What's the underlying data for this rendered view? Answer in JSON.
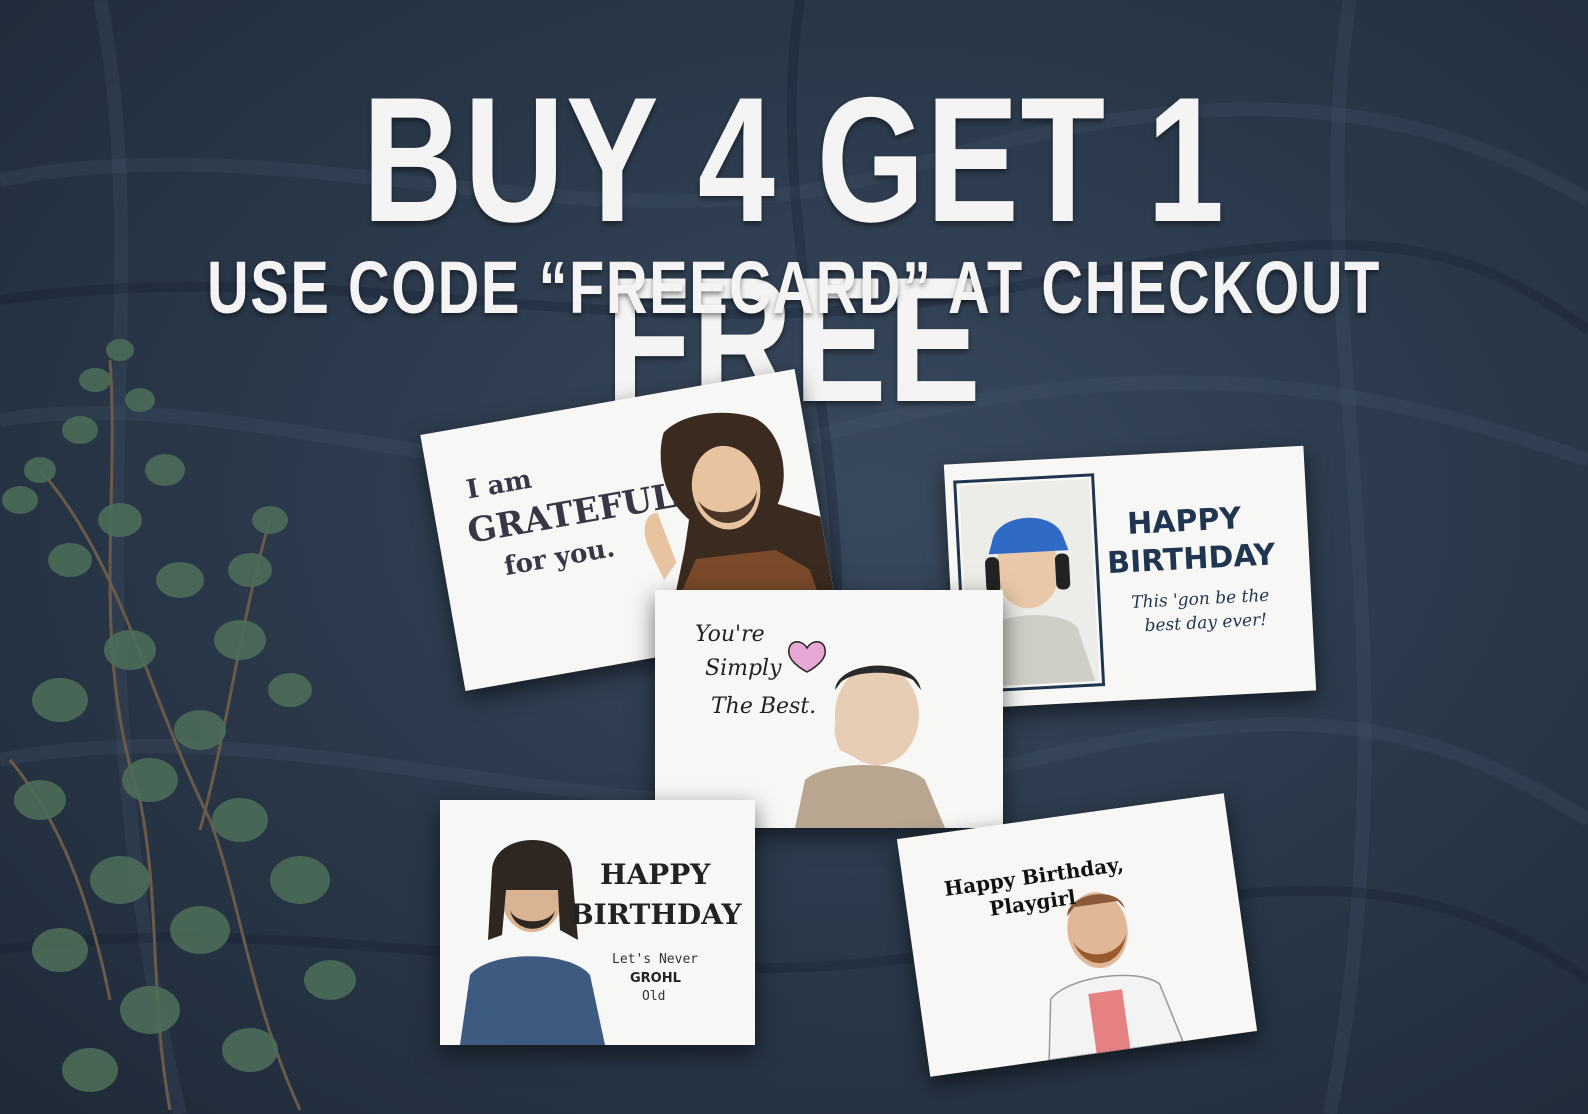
{
  "promo": {
    "headline": "BUY 4 GET 1 FREE",
    "subline": "USE CODE “FREECARD” AT CHECKOUT"
  },
  "cards": {
    "grateful": {
      "line1": "I am",
      "line2": "GRATEFUL",
      "line3": "for you."
    },
    "birthday_mac": {
      "line1": "HAPPY",
      "line2": "BIRTHDAY",
      "line3": "This 'gon be the",
      "line4": "best day ever!"
    },
    "simply_best": {
      "line1": "You're",
      "line2": "Simply",
      "line3": "The Best."
    },
    "grohl": {
      "line1": "HAPPY",
      "line2": "BIRTHDAY",
      "line3": "Let's Never",
      "line4": "GROHL",
      "line5": "Old"
    },
    "playgirl": {
      "line1": "Happy Birthday,",
      "line2": "Playgirl"
    }
  },
  "colors": {
    "background": "#2b3a4c",
    "card": "#f7f7f5",
    "text_dark": "#3a3648",
    "navy": "#1f3550",
    "heart": "#e7a8d6",
    "leaf": "#4d6b58"
  }
}
